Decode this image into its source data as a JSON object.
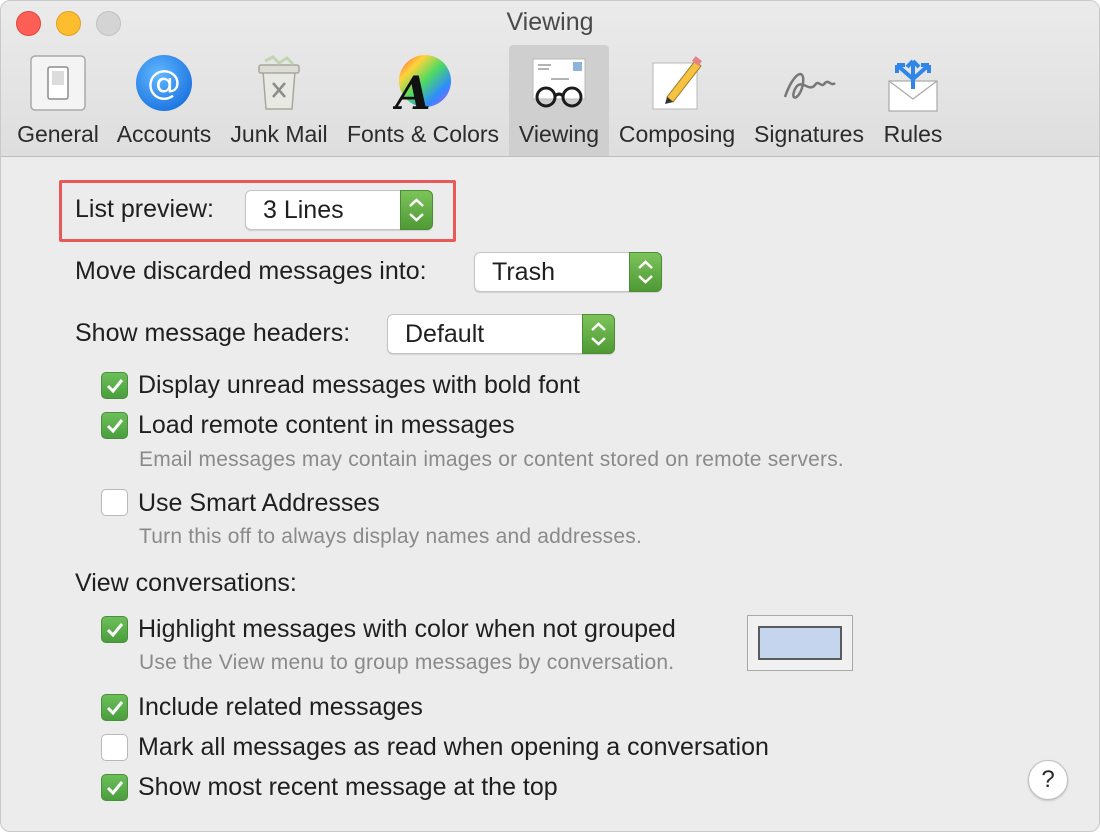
{
  "window": {
    "title": "Viewing"
  },
  "tabs": [
    {
      "label": "General",
      "icon": "general-switch-icon"
    },
    {
      "label": "Accounts",
      "icon": "at-sign-icon"
    },
    {
      "label": "Junk Mail",
      "icon": "trash-can-icon"
    },
    {
      "label": "Fonts & Colors",
      "icon": "color-wheel-font-icon"
    },
    {
      "label": "Viewing",
      "icon": "glasses-envelope-icon",
      "active": true
    },
    {
      "label": "Composing",
      "icon": "pencil-paper-icon"
    },
    {
      "label": "Signatures",
      "icon": "signature-icon"
    },
    {
      "label": "Rules",
      "icon": "envelope-arrows-icon"
    }
  ],
  "list_preview": {
    "label": "List preview:",
    "value": "3 Lines"
  },
  "move_discarded": {
    "label": "Move discarded messages into:",
    "value": "Trash"
  },
  "message_headers": {
    "label": "Show message headers:",
    "value": "Default"
  },
  "options": [
    {
      "label": "Display unread messages with bold font",
      "checked": true
    },
    {
      "label": "Load remote content in messages",
      "checked": true,
      "hint": "Email messages may contain images or content stored on remote servers."
    },
    {
      "label": "Use Smart Addresses",
      "checked": false,
      "hint": "Turn this off to always display names and addresses."
    }
  ],
  "conversations": {
    "heading": "View conversations:",
    "options": [
      {
        "label": "Highlight messages with color when not grouped",
        "checked": true,
        "hint": "Use the View menu to group messages by conversation."
      },
      {
        "label": "Include related messages",
        "checked": true
      },
      {
        "label": "Mark all messages as read when opening a conversation",
        "checked": false
      },
      {
        "label": "Show most recent message at the top",
        "checked": true
      }
    ],
    "highlight_color": "#c5d5ee"
  },
  "help": {
    "label": "?"
  },
  "colors": {
    "accent_green": "#5aaa45",
    "highlight_red": "#e8595a"
  }
}
